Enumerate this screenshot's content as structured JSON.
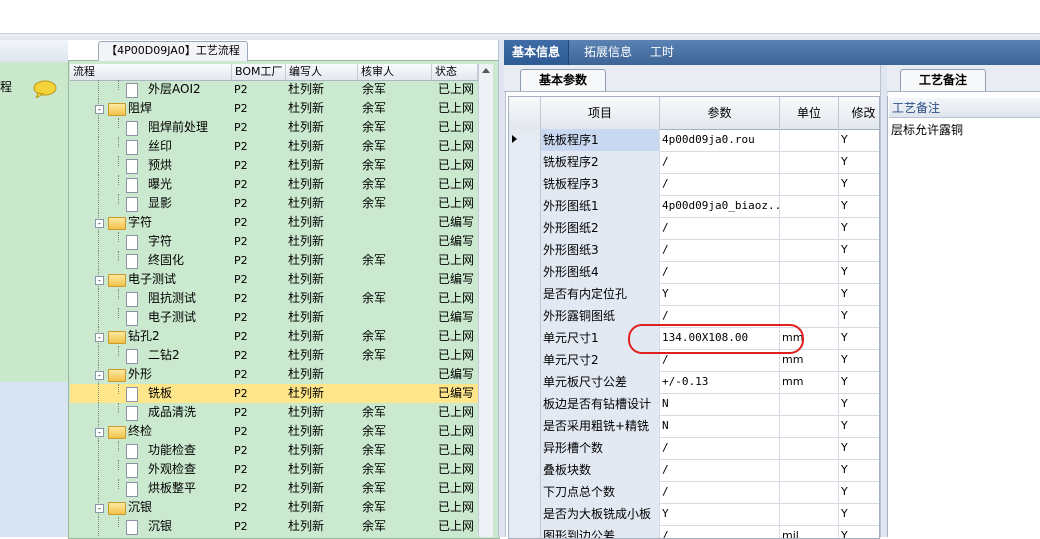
{
  "left_panel": {
    "header_text": "程"
  },
  "process_panel": {
    "tab_title": "【4P00D09JA0】工艺流程",
    "columns": {
      "flow": "流程",
      "bom": "BOM工厂",
      "writer": "编写人",
      "reviewer": "核审人",
      "status": "状态"
    },
    "rows": [
      {
        "level": 2,
        "type": "doc",
        "label": "外层AOI2",
        "bom": "P2",
        "writer": "杜列新",
        "reviewer": "余军",
        "status": "已上网"
      },
      {
        "level": 1,
        "type": "folder",
        "label": "阻焊",
        "bom": "P2",
        "writer": "杜列新",
        "reviewer": "余军",
        "status": "已上网"
      },
      {
        "level": 2,
        "type": "doc",
        "label": "阻焊前处理",
        "bom": "P2",
        "writer": "杜列新",
        "reviewer": "余军",
        "status": "已上网"
      },
      {
        "level": 2,
        "type": "doc",
        "label": "丝印",
        "bom": "P2",
        "writer": "杜列新",
        "reviewer": "余军",
        "status": "已上网"
      },
      {
        "level": 2,
        "type": "doc",
        "label": "预烘",
        "bom": "P2",
        "writer": "杜列新",
        "reviewer": "余军",
        "status": "已上网"
      },
      {
        "level": 2,
        "type": "doc",
        "label": "曝光",
        "bom": "P2",
        "writer": "杜列新",
        "reviewer": "余军",
        "status": "已上网"
      },
      {
        "level": 2,
        "type": "doc",
        "label": "显影",
        "bom": "P2",
        "writer": "杜列新",
        "reviewer": "余军",
        "status": "已上网"
      },
      {
        "level": 1,
        "type": "folder",
        "label": "字符",
        "bom": "P2",
        "writer": "杜列新",
        "reviewer": "",
        "status": "已编写"
      },
      {
        "level": 2,
        "type": "doc",
        "label": "字符",
        "bom": "P2",
        "writer": "杜列新",
        "reviewer": "",
        "status": "已编写"
      },
      {
        "level": 2,
        "type": "doc",
        "label": "终固化",
        "bom": "P2",
        "writer": "杜列新",
        "reviewer": "余军",
        "status": "已上网"
      },
      {
        "level": 1,
        "type": "folder",
        "label": "电子测试",
        "bom": "P2",
        "writer": "杜列新",
        "reviewer": "",
        "status": "已编写"
      },
      {
        "level": 2,
        "type": "doc",
        "label": "阻抗测试",
        "bom": "P2",
        "writer": "杜列新",
        "reviewer": "余军",
        "status": "已上网"
      },
      {
        "level": 2,
        "type": "doc",
        "label": "电子测试",
        "bom": "P2",
        "writer": "杜列新",
        "reviewer": "",
        "status": "已编写"
      },
      {
        "level": 1,
        "type": "folder",
        "label": "钻孔2",
        "bom": "P2",
        "writer": "杜列新",
        "reviewer": "余军",
        "status": "已上网"
      },
      {
        "level": 2,
        "type": "doc",
        "label": "二钻2",
        "bom": "P2",
        "writer": "杜列新",
        "reviewer": "余军",
        "status": "已上网"
      },
      {
        "level": 1,
        "type": "folder",
        "label": "外形",
        "bom": "P2",
        "writer": "杜列新",
        "reviewer": "",
        "status": "已编写"
      },
      {
        "level": 2,
        "type": "doc",
        "label": "铣板",
        "bom": "P2",
        "writer": "杜列新",
        "reviewer": "",
        "status": "已编写",
        "selected": true
      },
      {
        "level": 2,
        "type": "doc",
        "label": "成品清洗",
        "bom": "P2",
        "writer": "杜列新",
        "reviewer": "余军",
        "status": "已上网"
      },
      {
        "level": 1,
        "type": "folder",
        "label": "终检",
        "bom": "P2",
        "writer": "杜列新",
        "reviewer": "余军",
        "status": "已上网"
      },
      {
        "level": 2,
        "type": "doc",
        "label": "功能检查",
        "bom": "P2",
        "writer": "杜列新",
        "reviewer": "余军",
        "status": "已上网"
      },
      {
        "level": 2,
        "type": "doc",
        "label": "外观检查",
        "bom": "P2",
        "writer": "杜列新",
        "reviewer": "余军",
        "status": "已上网"
      },
      {
        "level": 2,
        "type": "doc",
        "label": "烘板整平",
        "bom": "P2",
        "writer": "杜列新",
        "reviewer": "余军",
        "status": "已上网"
      },
      {
        "level": 1,
        "type": "folder",
        "label": "沉银",
        "bom": "P2",
        "writer": "杜列新",
        "reviewer": "余军",
        "status": "已上网"
      },
      {
        "level": 2,
        "type": "doc",
        "label": "沉银",
        "bom": "P2",
        "writer": "杜列新",
        "reviewer": "余军",
        "status": "已上网"
      }
    ]
  },
  "tabs": {
    "basic": "基本信息",
    "extend": "拓展信息",
    "hours": "工时"
  },
  "params": {
    "sub_tab": "基本参数",
    "columns": {
      "item": "项目",
      "param": "参数",
      "unit": "单位",
      "mod": "修改"
    },
    "rows": [
      {
        "name": "铣板程序1",
        "value": "4p00d09ja0.rou",
        "unit": "",
        "mod": "Y",
        "current": true
      },
      {
        "name": "铣板程序2",
        "value": "/",
        "unit": "",
        "mod": "Y"
      },
      {
        "name": "铣板程序3",
        "value": "/",
        "unit": "",
        "mod": "Y"
      },
      {
        "name": "外形图纸1",
        "value": "4p00d09ja0_biaoz...",
        "unit": "",
        "mod": "Y"
      },
      {
        "name": "外形图纸2",
        "value": "/",
        "unit": "",
        "mod": "Y"
      },
      {
        "name": "外形图纸3",
        "value": "/",
        "unit": "",
        "mod": "Y"
      },
      {
        "name": "外形图纸4",
        "value": "/",
        "unit": "",
        "mod": "Y"
      },
      {
        "name": "是否有内定位孔",
        "value": "Y",
        "unit": "",
        "mod": "Y"
      },
      {
        "name": "外形露铜图纸",
        "value": "/",
        "unit": "",
        "mod": "Y"
      },
      {
        "name": "单元尺寸1",
        "value": "134.00X108.00",
        "unit": "mm",
        "mod": "Y"
      },
      {
        "name": "单元尺寸2",
        "value": "/",
        "unit": "mm",
        "mod": "Y"
      },
      {
        "name": "单元板尺寸公差",
        "value": "+/-0.13",
        "unit": "mm",
        "mod": "Y"
      },
      {
        "name": "板边是否有钻槽设计",
        "value": "N",
        "unit": "",
        "mod": "Y"
      },
      {
        "name": "是否采用粗铣+精铣",
        "value": "N",
        "unit": "",
        "mod": "Y"
      },
      {
        "name": "异形槽个数",
        "value": "/",
        "unit": "",
        "mod": "Y"
      },
      {
        "name": "叠板块数",
        "value": "/",
        "unit": "",
        "mod": "Y"
      },
      {
        "name": "下刀点总个数",
        "value": "/",
        "unit": "",
        "mod": "Y"
      },
      {
        "name": "是否为大板铣成小板",
        "value": "Y",
        "unit": "",
        "mod": "Y"
      },
      {
        "name": "图形到边公差",
        "value": "/",
        "unit": "mil",
        "mod": "Y"
      }
    ]
  },
  "remarks": {
    "tab": "工艺备注",
    "header": "工艺备注",
    "text": "层标允许露铜"
  }
}
